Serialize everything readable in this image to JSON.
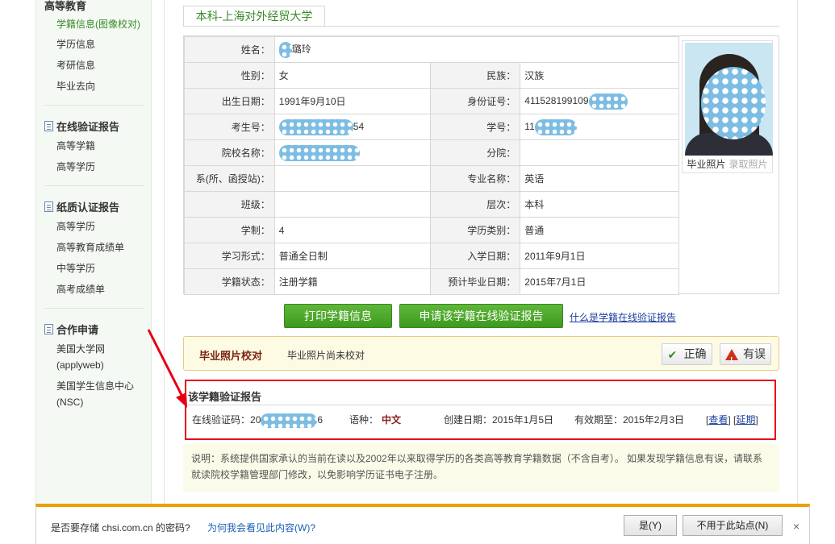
{
  "sidebar": {
    "top_head": "高等教育",
    "top_items": [
      "学籍信息(图像校对)",
      "学历信息",
      "考研信息",
      "毕业去向"
    ],
    "group2_head": "在线验证报告",
    "group2_items": [
      "高等学籍",
      "高等学历"
    ],
    "group3_head": "纸质认证报告",
    "group3_items": [
      "高等学历",
      "高等教育成绩单",
      "中等学历",
      "高考成绩单"
    ],
    "group4_head": "合作申请",
    "group4_items": [
      "美国大学网",
      "(applyweb)",
      "美国学生信息中心",
      "(NSC)"
    ]
  },
  "tab": {
    "label": "本科-上海对外经贸大学"
  },
  "info": {
    "rows": [
      {
        "l1": "姓名：",
        "v1": "璐玲"
      },
      {
        "l1": "性别：",
        "v1": "女",
        "l2": "民族：",
        "v2": "汉族"
      },
      {
        "l1": "出生日期：",
        "v1": "1991年9月10日",
        "l2": "身份证号：",
        "v2": "411528199109"
      },
      {
        "l1": "考生号：",
        "v1": "54",
        "l2": "学号：",
        "v2": "11"
      },
      {
        "l1": "院校名称：",
        "v1": "",
        "l2": "分院：",
        "v2": ""
      },
      {
        "l1": "系(所、函授站)：",
        "v1": "",
        "l2": "专业名称：",
        "v2": "英语"
      },
      {
        "l1": "班级：",
        "v1": "",
        "l2": "层次：",
        "v2": "本科"
      },
      {
        "l1": "学制：",
        "v1": "4",
        "l2": "学历类别：",
        "v2": "普通"
      },
      {
        "l1": "学习形式：",
        "v1": "普通全日制",
        "l2": "入学日期：",
        "v2": "2011年9月1日"
      },
      {
        "l1": "学籍状态：",
        "v1": "注册学籍",
        "l2": "预计毕业日期：",
        "v2": "2015年7月1日"
      }
    ],
    "photo_caption": "毕业照片",
    "photo_link": "录取照片"
  },
  "actions": {
    "print_label": "打印学籍信息",
    "apply_label": "申请该学籍在线验证报告",
    "what_link": "什么是学籍在线验证报告"
  },
  "photo_check": {
    "title": "毕业照片校对",
    "message": "毕业照片尚未校对",
    "correct_label": "正确",
    "error_label": "有误"
  },
  "report": {
    "title": "该学籍验证报告",
    "code_label": "在线验证码：",
    "code_prefix": "20",
    "code_suffix": "6",
    "lang_label": "语种：",
    "lang_value": "中文",
    "created": "创建日期：2015年1月5日",
    "valid": "有效期至：2015年2月3日",
    "view_link": "查看",
    "extend_link": "延期"
  },
  "notice": {
    "text": "说明：系统提供国家承认的当前在读以及2002年以来取得学历的各类高等教育学籍数据（不含自考）。 如果发现学籍信息有误，请联系就读院校学籍管理部门修改，以免影响学历证书电子注册。"
  },
  "password_bar": {
    "question": "是否要存储 chsi.com.cn 的密码?",
    "why_link": "为何我会看见此内容(W)?",
    "yes_label": "是(Y)",
    "never_label": "不用于此站点(N)",
    "close": "×"
  },
  "colors": {
    "accent_green": "#3d9a1f",
    "highlight_red": "#e60012",
    "bar_orange": "#e8a100"
  }
}
